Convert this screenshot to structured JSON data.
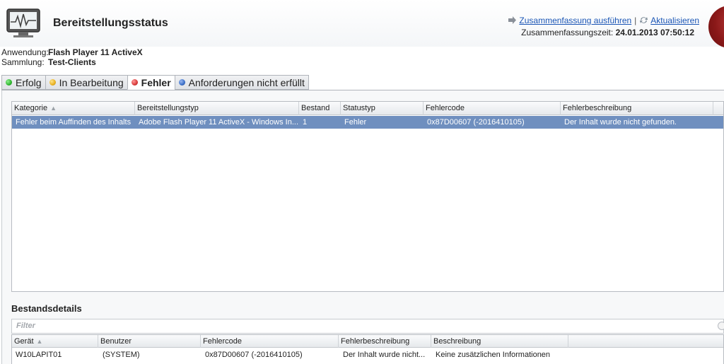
{
  "header": {
    "title": "Bereitstellungsstatus",
    "icon": "monitor-heartbeat-icon",
    "summarize_link": "Zusammenfassung ausführen",
    "separator": "|",
    "refresh_link": "Aktualisieren",
    "summary_time_label": "Zusammenfassungszeit:",
    "summary_time_value": "24.01.2013 07:50:12"
  },
  "meta": {
    "application_label": "Anwendung:",
    "application_value": "Flash Player 11 ActiveX",
    "collection_label": "Sammlung:",
    "collection_value": "Test-Clients"
  },
  "tabs": [
    {
      "label": "Erfolg",
      "color": "#2fb52f"
    },
    {
      "label": "In Bearbeitung",
      "color": "#e8b020"
    },
    {
      "label": "Fehler",
      "color": "#d83a3a",
      "active": true
    },
    {
      "label": "Anforderungen nicht erfüllt",
      "color": "#3a6fc8"
    }
  ],
  "status_grid": {
    "columns": [
      "Kategorie",
      "Bereitstellungstyp",
      "Bestand",
      "Statustyp",
      "Fehlercode",
      "Fehlerbeschreibung"
    ],
    "rows": [
      [
        "Fehler beim Auffinden des Inhalts",
        "Adobe Flash Player 11 ActiveX - Windows In...",
        "1",
        "Fehler",
        "0x87D00607 (-2016410105)",
        "Der Inhalt wurde nicht gefunden."
      ]
    ]
  },
  "details": {
    "title": "Bestandsdetails",
    "filter_placeholder": "Filter",
    "columns": [
      "Gerät",
      "Benutzer",
      "Fehlercode",
      "Fehlerbeschreibung",
      "Beschreibung"
    ],
    "rows": [
      [
        "W10LAPIT01",
        "(SYSTEM)",
        "0x87D00607 (-2016410105)",
        "Der Inhalt wurde nicht...",
        "Keine zusätzlichen Informationen"
      ]
    ]
  },
  "colors": {
    "selected_row": "#6f8fbf",
    "link": "#1a55b5",
    "accent_orb": "#8a1818"
  }
}
